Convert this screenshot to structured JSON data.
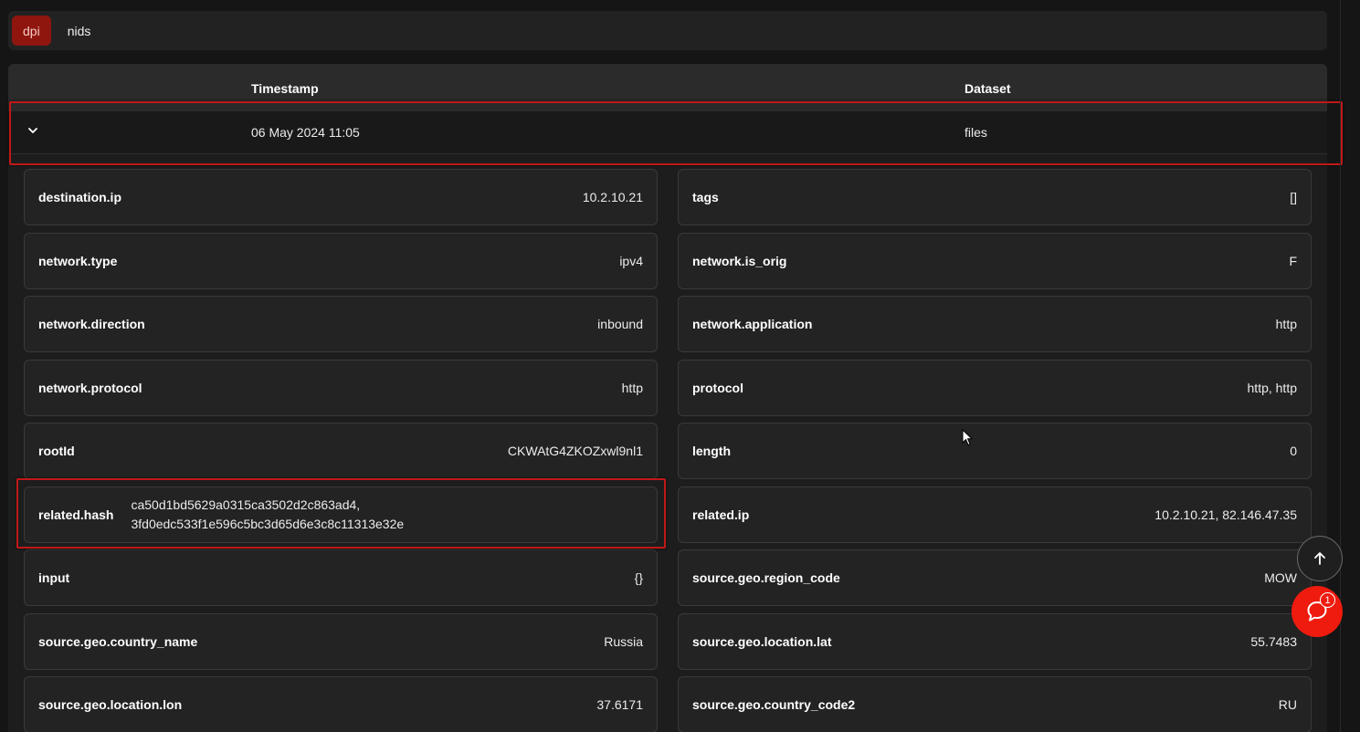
{
  "tabs": [
    {
      "label": "dpi",
      "active": true
    },
    {
      "label": "nids",
      "active": false
    }
  ],
  "table": {
    "columns": [
      "Timestamp",
      "Dataset"
    ],
    "row": {
      "timestamp": "06 May 2024 11:05",
      "dataset": "files"
    }
  },
  "fields": {
    "left": [
      {
        "key": "destination.ip",
        "value": "10.2.10.21"
      },
      {
        "key": "network.type",
        "value": "ipv4"
      },
      {
        "key": "network.direction",
        "value": "inbound"
      },
      {
        "key": "network.protocol",
        "value": "http"
      },
      {
        "key": "rootId",
        "value": "CKWAtG4ZKOZxwl9nl1"
      },
      {
        "key": "related.hash",
        "value": "ca50d1bd5629a0315ca3502d2c863ad4, 3fd0edc533f1e596c5bc3d65d6e3c8c11313e32e",
        "lines": [
          "ca50d1bd5629a0315ca3502d2c863ad4,",
          "3fd0edc533f1e596c5bc3d65d6e3c8c11313e32e"
        ]
      },
      {
        "key": "input",
        "value": "{}"
      },
      {
        "key": "source.geo.country_name",
        "value": "Russia"
      },
      {
        "key": "source.geo.location.lon",
        "value": "37.6171"
      }
    ],
    "right": [
      {
        "key": "tags",
        "value": "[]"
      },
      {
        "key": "network.is_orig",
        "value": "F"
      },
      {
        "key": "network.application",
        "value": "http"
      },
      {
        "key": "protocol",
        "value": "http, http"
      },
      {
        "key": "length",
        "value": "0"
      },
      {
        "key": "related.ip",
        "value": "10.2.10.21, 82.146.47.35"
      },
      {
        "key": "source.geo.region_code",
        "value": "MOW"
      },
      {
        "key": "source.geo.location.lat",
        "value": "55.7483"
      },
      {
        "key": "source.geo.country_code2",
        "value": "RU"
      }
    ]
  },
  "chat": {
    "badge_count": "1"
  },
  "icons": {
    "expand": "chevron-down-icon",
    "scroll_top": "arrow-up-icon",
    "chat": "chat-bubble-icon",
    "cursor": "mouse-pointer-icon"
  },
  "colors": {
    "accent": "#ef1b0e",
    "active_tab": "#8f160f",
    "highlight_border": "#c01818",
    "background": "#151515",
    "card": "#232323"
  }
}
